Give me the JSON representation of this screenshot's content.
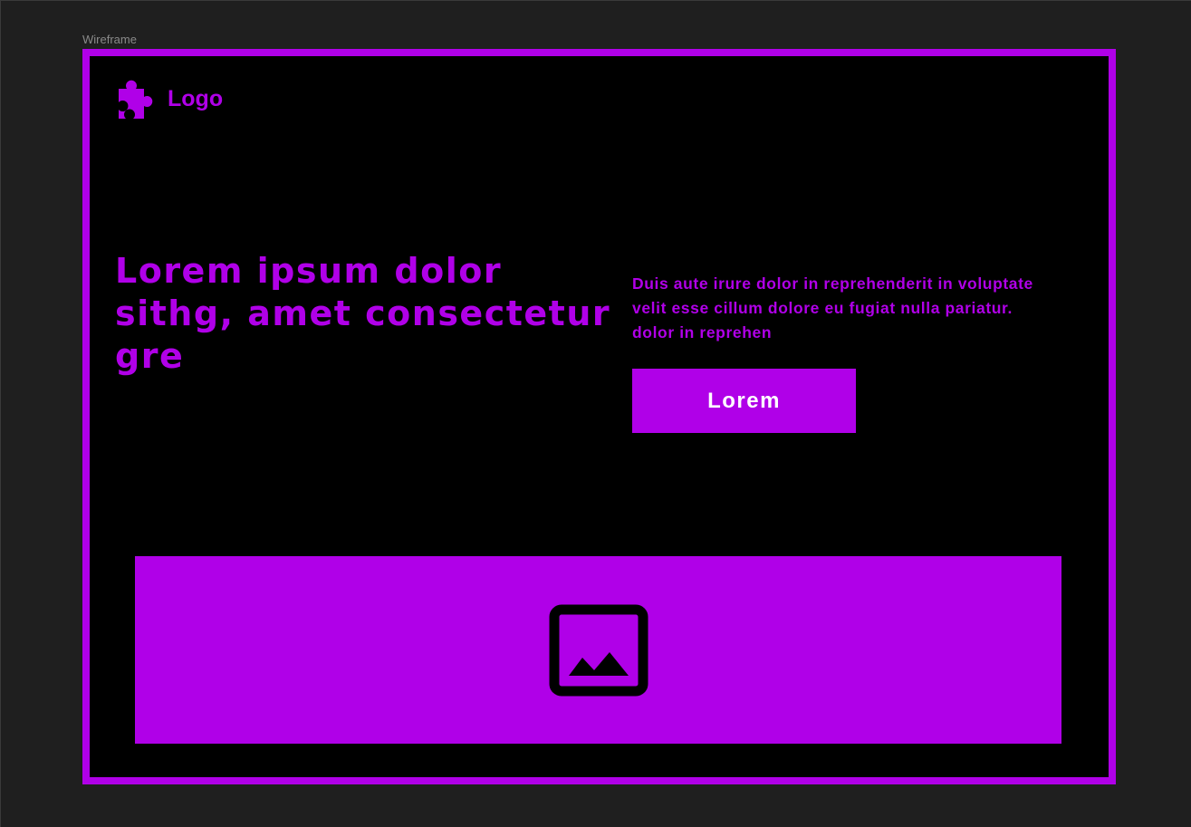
{
  "canvas": {
    "frame_label": "Wireframe"
  },
  "header": {
    "logo_text": "Logo",
    "logo_icon": "puzzle-piece-icon"
  },
  "hero": {
    "headline": "Lorem ipsum dolor sithg, amet consectetur  gre",
    "body": "Duis aute irure dolor in reprehenderit in voluptate velit esse cillum dolore eu fugiat nulla pariatur.  dolor in reprehen",
    "cta_label": "Lorem"
  },
  "media": {
    "icon": "image-icon"
  },
  "colors": {
    "accent": "#b000e8",
    "frame_background": "#000000",
    "canvas_background": "#1f1f1f",
    "button_text": "#ffffff"
  }
}
